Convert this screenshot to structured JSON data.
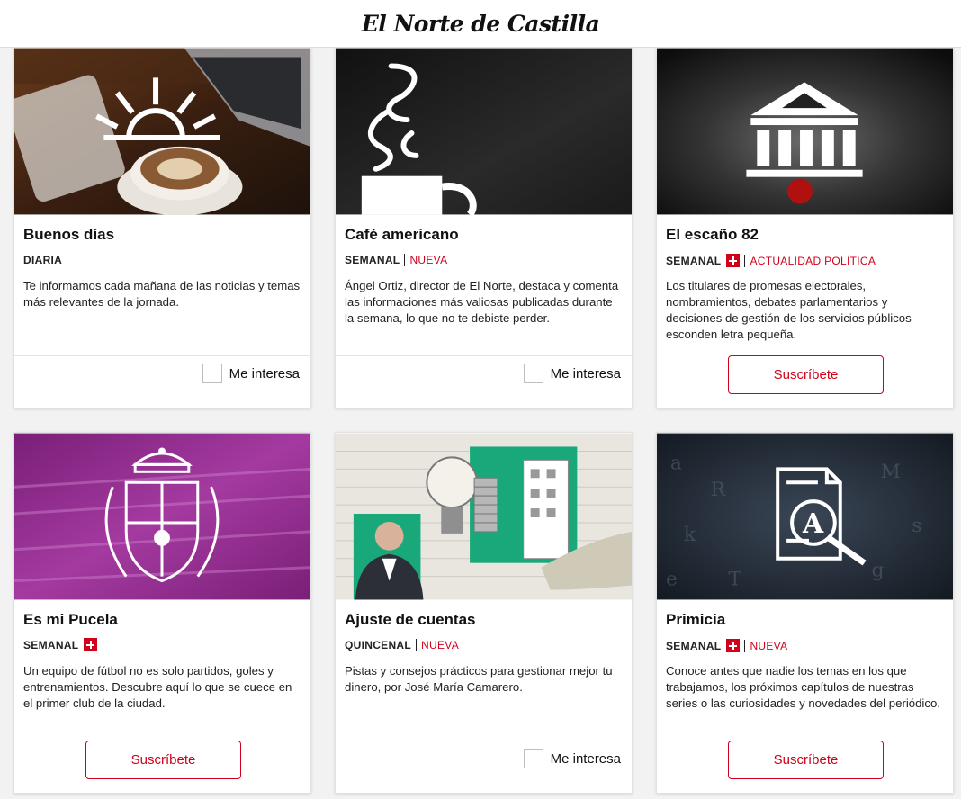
{
  "header": {
    "logo": "El Norte de Castilla"
  },
  "cards": [
    {
      "title": "Buenos días",
      "frequency": "DIARIA",
      "plus": false,
      "tag": "",
      "description": "Te informamos cada mañana de las noticias y temas más relevantes de la jornada.",
      "action": "Me interesa"
    },
    {
      "title": "Café americano",
      "frequency": "SEMANAL",
      "plus": false,
      "tag": "NUEVA",
      "description": "Ángel Ortiz, director de El Norte, destaca y comenta las informaciones más valiosas publicadas durante la semana, lo que no te debiste perder.",
      "action": "Me interesa"
    },
    {
      "title": "El escaño 82",
      "frequency": "SEMANAL",
      "plus": true,
      "tag": "ACTUALIDAD POLÍTICA",
      "description": "Los titulares de promesas electorales, nombramientos, debates parlamentarios y decisiones de gestión de los servicios públicos esconden letra pequeña.",
      "action": "Suscríbete"
    },
    {
      "title": "Es mi Pucela",
      "frequency": "SEMANAL",
      "plus": true,
      "tag": "",
      "description": "Un equipo de fútbol no es solo partidos, goles y entrenamientos. Descubre aquí lo que se cuece en el primer club de la ciudad.",
      "action": "Suscríbete"
    },
    {
      "title": "Ajuste de cuentas",
      "frequency": "QUINCENAL",
      "plus": false,
      "tag": "NUEVA",
      "description": "Pistas y consejos prácticos para gestionar mejor tu dinero, por José María Camarero.",
      "action": "Me interesa"
    },
    {
      "title": "Primicia",
      "frequency": "SEMANAL",
      "plus": true,
      "tag": "NUEVA",
      "description": "Conoce antes que nadie los temas en los que trabajamos, los próximos capítulos de nuestras series o las curiosidades y novedades del periódico.",
      "action": "Suscríbete"
    }
  ],
  "colors": {
    "accent": "#d0021b",
    "pucela_purple": "#8e2a8e",
    "dark": "#1b1b1b"
  },
  "icons": [
    "sunrise-icon",
    "steaming-cup-icon",
    "parliament-icon",
    "club-crest-icon",
    "lightbulb-coins-collage",
    "document-magnifier-icon",
    "plus-badge-icon",
    "checkbox-icon"
  ]
}
